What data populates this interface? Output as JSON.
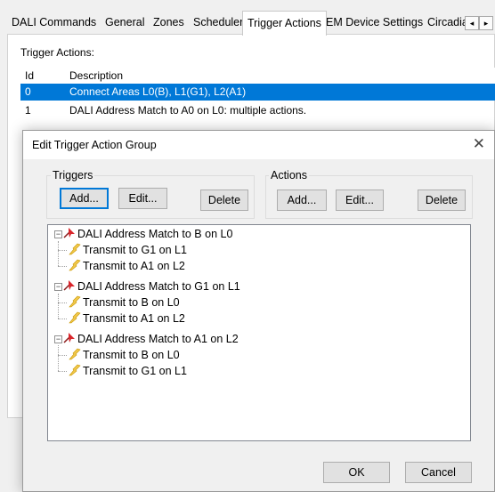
{
  "tabs": [
    {
      "label": "DALI Commands"
    },
    {
      "label": "General"
    },
    {
      "label": "Zones"
    },
    {
      "label": "Scheduler"
    },
    {
      "label": "Trigger Actions",
      "active": true
    },
    {
      "label": "EM Device Settings"
    },
    {
      "label": "Circadia"
    }
  ],
  "tab_scroll": {
    "left": "◂",
    "right": "▸"
  },
  "trigger_actions": {
    "label": "Trigger Actions:",
    "columns": [
      "Id",
      "Description"
    ],
    "rows": [
      {
        "id": "0",
        "description": "Connect Areas L0(B), L1(G1), L2(A1)",
        "selected": true
      },
      {
        "id": "1",
        "description": "DALI Address Match to A0 on L0: multiple actions."
      }
    ]
  },
  "dialog": {
    "title": "Edit Trigger Action Group",
    "close_glyph": "✕",
    "triggers_group": {
      "label": "Triggers",
      "add": "Add...",
      "edit": "Edit...",
      "delete": "Delete"
    },
    "actions_group": {
      "label": "Actions",
      "add": "Add...",
      "edit": "Edit...",
      "delete": "Delete"
    },
    "tree": [
      {
        "label": "DALI Address Match to B on L0",
        "children": [
          "Transmit to G1 on L1",
          "Transmit to A1 on L2"
        ]
      },
      {
        "label": "DALI Address Match to G1 on L1",
        "children": [
          "Transmit to B on L0",
          "Transmit to A1 on L2"
        ]
      },
      {
        "label": "DALI Address Match to A1 on L2",
        "children": [
          "Transmit to B on L0",
          "Transmit to G1 on L1"
        ]
      }
    ],
    "ok": "OK",
    "cancel": "Cancel",
    "expander_glyph": "−"
  },
  "colors": {
    "selection": "#0078d7",
    "trigger_icon": "#d9262c",
    "action_icon": "#e8b400"
  }
}
